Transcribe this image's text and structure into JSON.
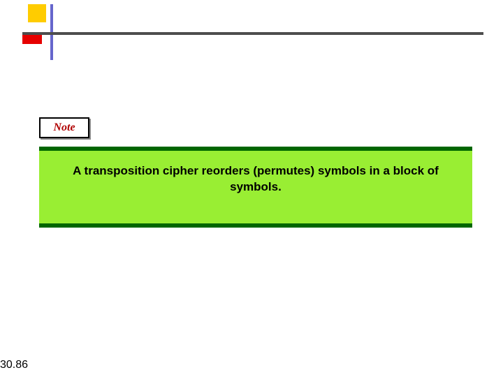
{
  "labels": {
    "note": "Note"
  },
  "content": {
    "body_text": "A transposition cipher reorders (permutes) symbols in a block of symbols."
  },
  "meta": {
    "slide_number": "30.86"
  },
  "colors": {
    "accent_yellow": "#ffcc00",
    "accent_red": "#e60000",
    "accent_blue": "#6666cc",
    "rule_gray": "#4d4d4d",
    "note_text": "#b00000",
    "green_dark": "#006600",
    "green_light": "#99ee33"
  }
}
